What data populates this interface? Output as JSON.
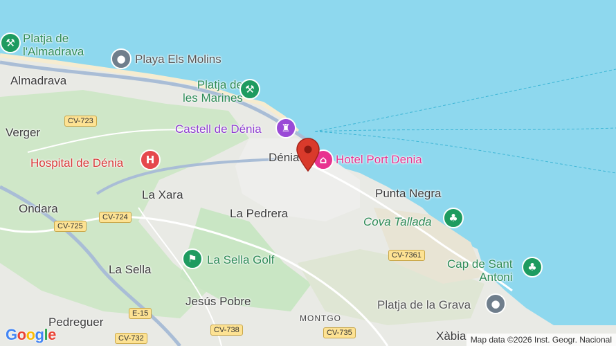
{
  "map": {
    "colors": {
      "sea": "#8ed8ee",
      "land": "#e9eae5",
      "green": "#c9e6c4",
      "highway": "#a9bdd6",
      "pin": "#d93a2b"
    },
    "labels": {
      "platja_almadrava": "Platja de\nl'Almadrava",
      "playa_els_molins": "Playa Els Molins",
      "almadrava": "Almadrava",
      "platja_marines": "Platja de\nles Marines",
      "verger": "Verger",
      "castell": "Castell de Dénia",
      "denia": "Dénia",
      "hotel": "Hotel Port Denia",
      "hospital": "Hospital de Dénia",
      "la_xara": "La Xara",
      "punta_negra": "Punta Negra",
      "ondara": "Ondara",
      "la_pedrera": "La Pedrera",
      "cova_tallada": "Cova Tallada",
      "la_sella_golf": "La Sella Golf",
      "cap_sant_antoni": "Cap de Sant\nAntoni",
      "la_sella": "La Sella",
      "jesus_pobre": "Jesús Pobre",
      "platja_grava": "Platja de la Grava",
      "pedreguer": "Pedreguer",
      "montgo": "MONTGO",
      "xabia": "Xàbia"
    },
    "roads": {
      "cv723": "CV-723",
      "cv725": "CV-725",
      "cv724": "CV-724",
      "cv7361": "CV-7361",
      "e15": "E-15",
      "cv738": "CV-738",
      "cv735": "CV-735",
      "cv732": "CV-732"
    },
    "icons": {
      "beach": "beach-icon",
      "place": "place-icon",
      "castle": "castle-icon",
      "hotel": "hotel-icon",
      "hospital": "hospital-icon",
      "park": "park-icon",
      "golf": "golf-icon",
      "pin": "location-pin-icon"
    },
    "logo": "Google",
    "attribution": "Map data ©2026 Inst. Geogr. Nacional"
  }
}
